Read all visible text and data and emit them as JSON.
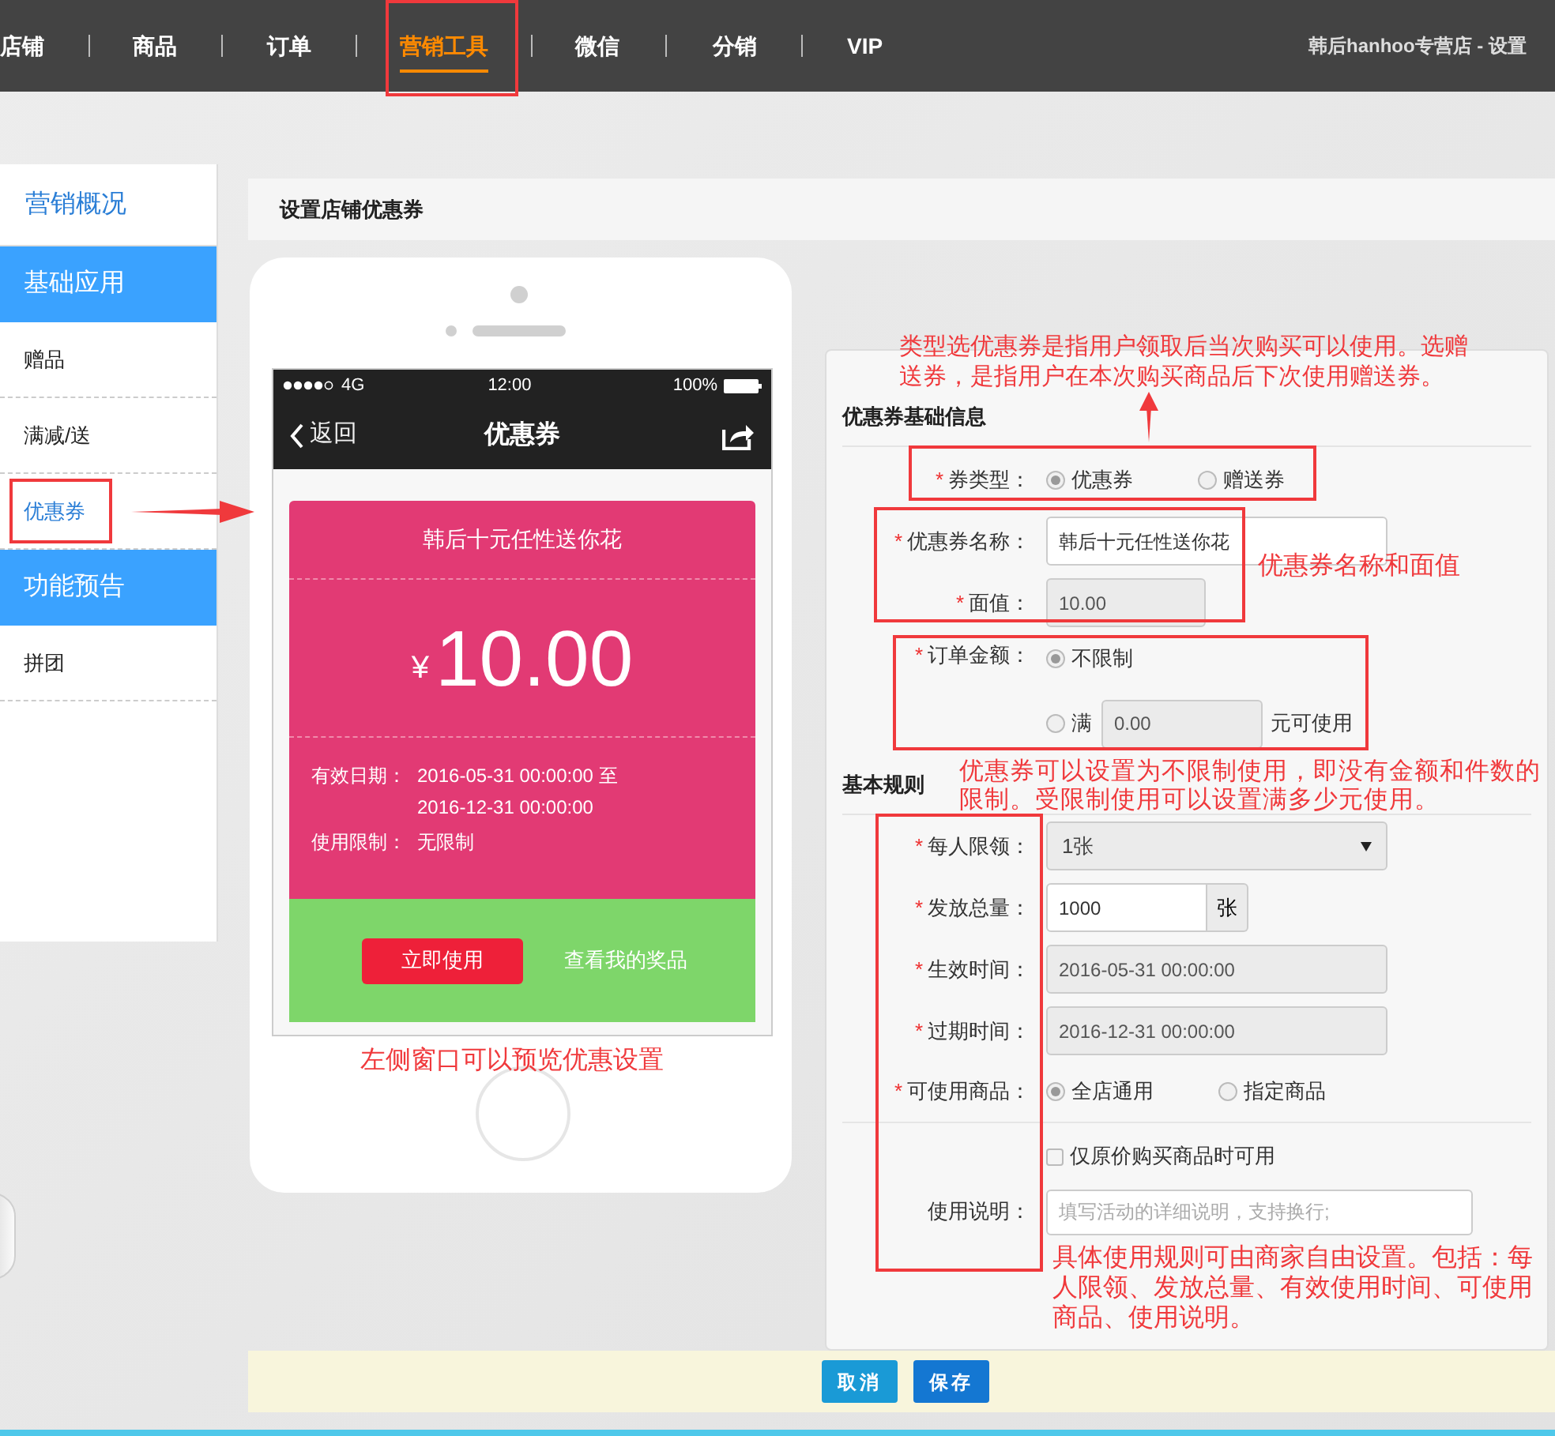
{
  "nav": {
    "items": [
      {
        "label": "店铺",
        "selected": false
      },
      {
        "label": "商品",
        "selected": false
      },
      {
        "label": "订单",
        "selected": false
      },
      {
        "label": "营销工具",
        "selected": true
      },
      {
        "label": "微信",
        "selected": false
      },
      {
        "label": "分销",
        "selected": false
      },
      {
        "label": "VIP",
        "selected": false
      }
    ],
    "store_link": "韩后hanhoo专营店 - 设置"
  },
  "sidebar": {
    "items": [
      {
        "label": "营销概况",
        "kind": "top",
        "selected": false
      },
      {
        "label": "基础应用",
        "kind": "group",
        "selected": false
      },
      {
        "label": "赠品",
        "kind": "item",
        "selected": false
      },
      {
        "label": "满减/送",
        "kind": "item",
        "selected": false
      },
      {
        "label": "优惠券",
        "kind": "item",
        "selected": true
      },
      {
        "label": "功能预告",
        "kind": "group",
        "selected": false
      },
      {
        "label": "拼团",
        "kind": "item",
        "selected": false
      }
    ]
  },
  "page_title": "设置店铺优惠券",
  "preview": {
    "status_bar": {
      "network": "4G",
      "time": "12:00",
      "battery": "100%"
    },
    "nav_bar": {
      "back": "返回",
      "title": "优惠券"
    },
    "coupon": {
      "name": "韩后十元任性送你花",
      "currency": "¥",
      "amount": "10.00",
      "validity_label": "有效日期：",
      "validity_start": "2016-05-31 00:00:00 至",
      "validity_end": "2016-12-31 00:00:00",
      "limit_label": "使用限制：",
      "limit": "无限制"
    },
    "use_button": "立即使用",
    "prizes_link": "查看我的奖品"
  },
  "form": {
    "sections": [
      {
        "title": "优惠券基础信息",
        "fields": [
          {
            "kind": "radio",
            "label": "券类型：",
            "required": "*",
            "options": [
              {
                "label": "优惠券",
                "selected": true
              },
              {
                "label": "赠送券",
                "selected": false
              }
            ]
          },
          {
            "kind": "text",
            "label": "优惠券名称：",
            "required": "*",
            "value": "韩后十元任性送你花",
            "disabled": false
          },
          {
            "kind": "short_text",
            "label": "面值：",
            "required": "*",
            "value": "10.00",
            "disabled": true
          },
          {
            "kind": "amount",
            "label": "订单金额：",
            "required": "*",
            "unlimited": {
              "label": "不限制",
              "selected": true
            },
            "minimum": {
              "label": "满",
              "selected": false,
              "value": "0.00",
              "suffix": "元可使用"
            }
          }
        ]
      },
      {
        "title": "基本规则",
        "fields": [
          {
            "kind": "select",
            "label": "每人限领：",
            "required": "*",
            "value": "1张"
          },
          {
            "kind": "addon",
            "label": "发放总量：",
            "required": "*",
            "value": "1000",
            "unit": "张"
          },
          {
            "kind": "text",
            "label": "生效时间：",
            "required": "*",
            "value": "2016-05-31 00:00:00",
            "disabled": true
          },
          {
            "kind": "text",
            "label": "过期时间：",
            "required": "*",
            "value": "2016-12-31 00:00:00",
            "disabled": true
          },
          {
            "kind": "radio",
            "label": "可使用商品：",
            "required": "*",
            "options": [
              {
                "label": "全店通用",
                "selected": true
              },
              {
                "label": "指定商品",
                "selected": false
              }
            ]
          },
          {
            "kind": "checkbox",
            "label": "仅原价购买商品时可用",
            "checked": false
          },
          {
            "kind": "textarea",
            "label": "使用说明：",
            "placeholder": "填写活动的详细说明，支持换行;"
          }
        ]
      }
    ],
    "buttons": [
      {
        "label": "取消",
        "kind": "cancel"
      },
      {
        "label": "保存",
        "kind": "save"
      }
    ]
  },
  "annotations": {
    "type_note": "类型选优惠券是指用户领取后当次购买可以使用。选赠送券，是指用户在本次购买商品后下次使用赠送券。",
    "name_note": "优惠券名称和面值",
    "amount_note": "优惠券可以设置为不限制使用，即没有金额和件数的限制。受限制使用可以设置满多少元使用。",
    "rules_note": "具体使用规则可由商家自由设置。包括：每人限领、发放总量、有效使用时间、可使用商品、使用说明。",
    "preview_note": "左侧窗口可以预览优惠设置"
  }
}
